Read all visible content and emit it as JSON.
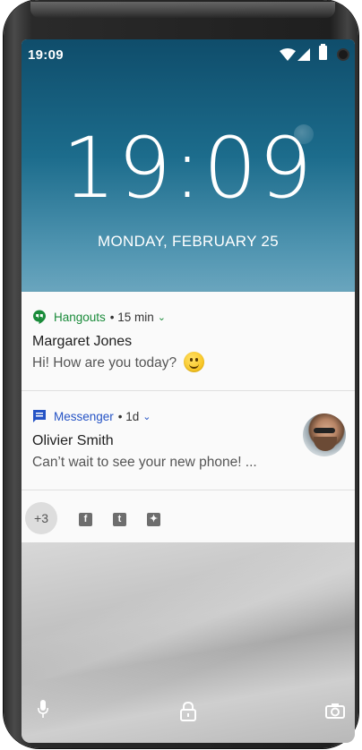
{
  "status_bar": {
    "time": "19:09"
  },
  "lock_screen": {
    "clock": "19:09",
    "date": "MONDAY, FEBRUARY 25"
  },
  "notifications": [
    {
      "app": "Hangouts",
      "meta": "• 15 min",
      "sender": "Margaret Jones",
      "message": "Hi! How are you today?",
      "app_color": "#1a8b3a",
      "icon": "hangouts-icon"
    },
    {
      "app": "Messenger",
      "meta": "• 1d",
      "sender": "Olivier Smith",
      "message": "Can’t wait to see your new phone! ...",
      "app_color": "#2553c5",
      "icon": "messenger-icon"
    }
  ],
  "more": {
    "count": "+3"
  },
  "social_icons": [
    "facebook-icon",
    "tumblr-icon",
    "twitter-icon"
  ],
  "bottom_actions": [
    "mic-icon",
    "lock-icon",
    "camera-icon"
  ]
}
